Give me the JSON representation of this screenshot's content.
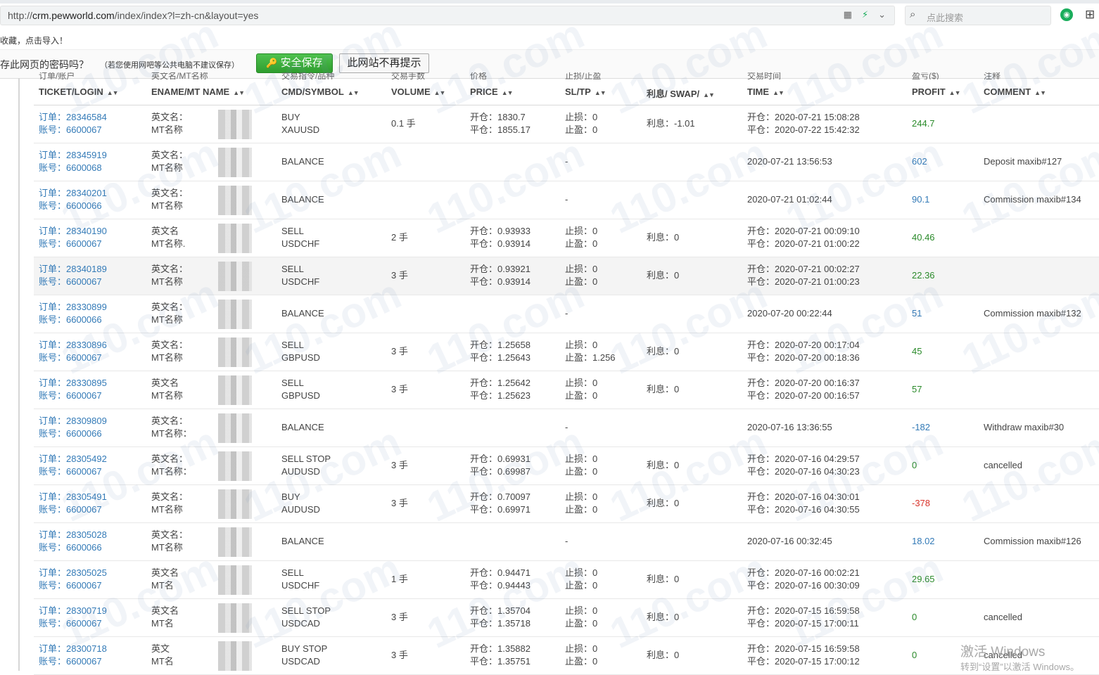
{
  "browser": {
    "url_prefix": "http://",
    "url_domain": "crm.pewworld.com",
    "url_path": "/index/index?l=zh-cn&layout=yes",
    "search_placeholder": "点此搜索"
  },
  "bookmark_hint": "收藏，点击导入！",
  "password_bar": {
    "question": "存此网页的密码吗？",
    "note": "（若您使用网吧等公共电脑不建议保存）",
    "save_label": "安全保存",
    "never_label": "此网站不再提示"
  },
  "columns": [
    {
      "zh": "订单/账户",
      "en": "TICKET/LOGIN"
    },
    {
      "zh": "英文名/MT名称",
      "en": "ENAME/MT NAME"
    },
    {
      "zh": "交易指令/品种",
      "en": "CMD/SYMBOL"
    },
    {
      "zh": "交易手数",
      "en": "VOLUME"
    },
    {
      "zh": "价格",
      "en": "PRICE"
    },
    {
      "zh": "止损/止盈",
      "en": "SL/TP"
    },
    {
      "zh": "",
      "en": "利息/ SWAP/"
    },
    {
      "zh": "交易时间",
      "en": "TIME"
    },
    {
      "zh": "盈亏($)",
      "en": "PROFIT"
    },
    {
      "zh": "注释",
      "en": "COMMENT"
    }
  ],
  "rows": [
    {
      "ticket": "订单：28346584",
      "login": "账号：6600067",
      "ename": "英文名：",
      "mtname": "MT名称",
      "cmd": "BUY",
      "symbol": "XAUUSD",
      "volume": "0.1 手",
      "open_price": "开仓：1830.7",
      "close_price": "平仓：1855.17",
      "sl": "止损：0",
      "tp": "止盈：0",
      "swap": "利息：-1.01",
      "open_time": "开仓：2020-07-21 15:08:28",
      "close_time": "平仓：2020-07-22 15:42:32",
      "profit": "244.7",
      "comment": "",
      "balance": false,
      "color": "green"
    },
    {
      "ticket": "订单：28345919",
      "login": "账号：6600068",
      "ename": "英文名：",
      "mtname": "MT名称",
      "cmd": "BALANCE",
      "dash": "-",
      "time": "2020-07-21 13:56:53",
      "profit": "602",
      "comment": "Deposit maxib#127",
      "balance": true,
      "color": "blue"
    },
    {
      "ticket": "订单：28340201",
      "login": "账号：6600066",
      "ename": "英文名：",
      "mtname": "MT名称",
      "cmd": "BALANCE",
      "dash": "-",
      "time": "2020-07-21 01:02:44",
      "profit": "90.1",
      "comment": "Commission maxib#134",
      "balance": true,
      "color": "blue"
    },
    {
      "ticket": "订单：28340190",
      "login": "账号：6600067",
      "ename": "英文名",
      "mtname": "MT名称.",
      "cmd": "SELL",
      "symbol": "USDCHF",
      "volume": "2 手",
      "open_price": "开仓：0.93933",
      "close_price": "平仓：0.93914",
      "sl": "止损：0",
      "tp": "止盈：0",
      "swap": "利息：0",
      "open_time": "开仓：2020-07-21 00:09:10",
      "close_time": "平仓：2020-07-21 01:00:22",
      "profit": "40.46",
      "comment": "",
      "balance": false,
      "color": "green"
    },
    {
      "ticket": "订单：28340189",
      "login": "账号：6600067",
      "ename": "英文名：",
      "mtname": "MT名称",
      "cmd": "SELL",
      "symbol": "USDCHF",
      "volume": "3 手",
      "open_price": "开仓：0.93921",
      "close_price": "平仓：0.93914",
      "sl": "止损：0",
      "tp": "止盈：0",
      "swap": "利息：0",
      "open_time": "开仓：2020-07-21 00:02:27",
      "close_time": "平仓：2020-07-21 01:00:23",
      "profit": "22.36",
      "comment": "",
      "balance": false,
      "color": "green"
    },
    {
      "ticket": "订单：28330899",
      "login": "账号：6600066",
      "ename": "英文名：",
      "mtname": "MT名称",
      "cmd": "BALANCE",
      "dash": "-",
      "time": "2020-07-20 00:22:44",
      "profit": "51",
      "comment": "Commission maxib#132",
      "balance": true,
      "color": "blue"
    },
    {
      "ticket": "订单：28330896",
      "login": "账号：6600067",
      "ename": "英文名：",
      "mtname": "MT名称",
      "cmd": "SELL",
      "symbol": "GBPUSD",
      "volume": "3 手",
      "open_price": "开仓：1.25658",
      "close_price": "平仓：1.25643",
      "sl": "止损：0",
      "tp": "止盈：1.256",
      "swap": "利息：0",
      "open_time": "开仓：2020-07-20 00:17:04",
      "close_time": "平仓：2020-07-20 00:18:36",
      "profit": "45",
      "comment": "",
      "balance": false,
      "color": "green"
    },
    {
      "ticket": "订单：28330895",
      "login": "账号：6600067",
      "ename": "英文名",
      "mtname": "MT名称",
      "cmd": "SELL",
      "symbol": "GBPUSD",
      "volume": "3 手",
      "open_price": "开仓：1.25642",
      "close_price": "平仓：1.25623",
      "sl": "止损：0",
      "tp": "止盈：0",
      "swap": "利息：0",
      "open_time": "开仓：2020-07-20 00:16:37",
      "close_time": "平仓：2020-07-20 00:16:57",
      "profit": "57",
      "comment": "",
      "balance": false,
      "color": "green"
    },
    {
      "ticket": "订单：28309809",
      "login": "账号：6600066",
      "ename": "英文名：",
      "mtname": "MT名称：",
      "cmd": "BALANCE",
      "dash": "-",
      "time": "2020-07-16 13:36:55",
      "profit": "-182",
      "comment": "Withdraw maxib#30",
      "balance": true,
      "color": "blue"
    },
    {
      "ticket": "订单：28305492",
      "login": "账号：6600067",
      "ename": "英文名：",
      "mtname": "MT名称：",
      "cmd": "SELL STOP",
      "symbol": "AUDUSD",
      "volume": "3 手",
      "open_price": "开仓：0.69931",
      "close_price": "平仓：0.69987",
      "sl": "止损：0",
      "tp": "止盈：0",
      "swap": "利息：0",
      "open_time": "开仓：2020-07-16 04:29:57",
      "close_time": "平仓：2020-07-16 04:30:23",
      "profit": "0",
      "comment": "cancelled",
      "balance": false,
      "color": "green"
    },
    {
      "ticket": "订单：28305491",
      "login": "账号：6600067",
      "ename": "英文名：",
      "mtname": "MT名称",
      "cmd": "BUY",
      "symbol": "AUDUSD",
      "volume": "3 手",
      "open_price": "开仓：0.70097",
      "close_price": "平仓：0.69971",
      "sl": "止损：0",
      "tp": "止盈：0",
      "swap": "利息：0",
      "open_time": "开仓：2020-07-16 04:30:01",
      "close_time": "平仓：2020-07-16 04:30:55",
      "profit": "-378",
      "comment": "",
      "balance": false,
      "color": "red"
    },
    {
      "ticket": "订单：28305028",
      "login": "账号：6600066",
      "ename": "英文名：",
      "mtname": "MT名称",
      "cmd": "BALANCE",
      "dash": "-",
      "time": "2020-07-16 00:32:45",
      "profit": "18.02",
      "comment": "Commission maxib#126",
      "balance": true,
      "color": "blue"
    },
    {
      "ticket": "订单：28305025",
      "login": "账号：6600067",
      "ename": "英文名",
      "mtname": "MT名",
      "cmd": "SELL",
      "symbol": "USDCHF",
      "volume": "1 手",
      "open_price": "开仓：0.94471",
      "close_price": "平仓：0.94443",
      "sl": "止损：0",
      "tp": "止盈：0",
      "swap": "利息：0",
      "open_time": "开仓：2020-07-16 00:02:21",
      "close_time": "平仓：2020-07-16 00:30:09",
      "profit": "29.65",
      "comment": "",
      "balance": false,
      "color": "green"
    },
    {
      "ticket": "订单：28300719",
      "login": "账号：6600067",
      "ename": "英文名",
      "mtname": "MT名",
      "cmd": "SELL STOP",
      "symbol": "USDCAD",
      "volume": "3 手",
      "open_price": "开仓：1.35704",
      "close_price": "平仓：1.35718",
      "sl": "止损：0",
      "tp": "止盈：0",
      "swap": "利息：0",
      "open_time": "开仓：2020-07-15 16:59:58",
      "close_time": "平仓：2020-07-15 17:00:11",
      "profit": "0",
      "comment": "cancelled",
      "balance": false,
      "color": "green"
    },
    {
      "ticket": "订单：28300718",
      "login": "账号：6600067",
      "ename": "英文",
      "mtname": "MT名",
      "cmd": "BUY STOP",
      "symbol": "USDCAD",
      "volume": "3 手",
      "open_price": "开仓：1.35882",
      "close_price": "平仓：1.35751",
      "sl": "止损：0",
      "tp": "止盈：0",
      "swap": "利息：0",
      "open_time": "开仓：2020-07-15 16:59:58",
      "close_time": "平仓：2020-07-15 17:00:12",
      "profit": "0",
      "comment": "cancelled",
      "balance": false,
      "color": "green"
    }
  ],
  "watermark": "110.com",
  "activation": {
    "line1": "激活 Windows",
    "line2": "转到“设置”以激活 Windows。"
  },
  "colors": {
    "link": "#337ab7",
    "profit_green": "#2a8a2a",
    "loss_red": "#d9342b",
    "save_green": "#3aab3a"
  }
}
